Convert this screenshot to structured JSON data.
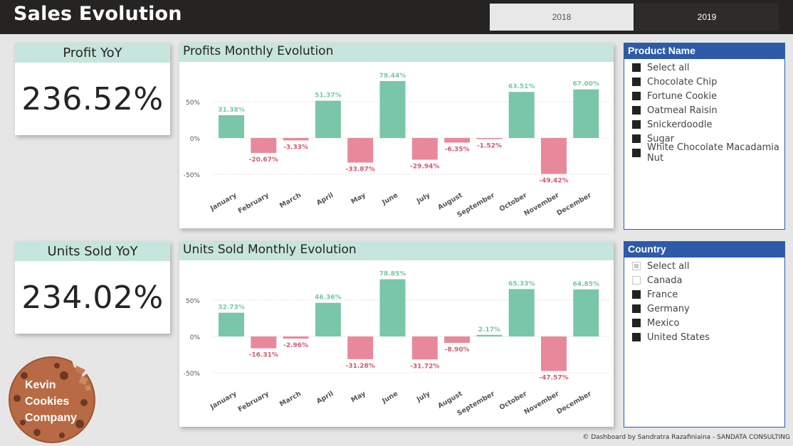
{
  "header": {
    "title": "Sales Evolution",
    "years": [
      "2018",
      "2019"
    ],
    "selected_year": "2019"
  },
  "kpis": {
    "profit": {
      "label": "Profit YoY",
      "value": "236.52%"
    },
    "units": {
      "label": "Units Sold YoY",
      "value": "234.02%"
    }
  },
  "colors": {
    "positive": "#79c6a9",
    "negative": "#e8899b",
    "positive_label": "#79c6a9",
    "negative_label": "#d25a72",
    "header_fill": "#c6e5dc",
    "slicer_blue": "#2d5ba8"
  },
  "chart_data": [
    {
      "type": "bar",
      "title": "Profits Monthly Evolution",
      "categories": [
        "January",
        "February",
        "March",
        "April",
        "May",
        "June",
        "July",
        "August",
        "September",
        "October",
        "November",
        "December"
      ],
      "values": [
        31.38,
        -20.67,
        -3.33,
        51.37,
        -33.87,
        78.44,
        -29.94,
        -6.35,
        -1.52,
        63.51,
        -49.42,
        67.0
      ],
      "data_labels": [
        "31.38%",
        "-20.67%",
        "-3.33%",
        "51.37%",
        "-33.87%",
        "78.44%",
        "-29.94%",
        "-6.35%",
        "-1.52%",
        "63.51%",
        "-49.42%",
        "67.00%"
      ],
      "yticks": [
        50,
        0,
        -50
      ],
      "ytick_labels": [
        "50%",
        "0%",
        "-50%"
      ],
      "ylim": [
        -50,
        80
      ],
      "grid": true,
      "legend": "none"
    },
    {
      "type": "bar",
      "title": "Units Sold Monthly Evolution",
      "categories": [
        "January",
        "February",
        "March",
        "April",
        "May",
        "June",
        "July",
        "August",
        "September",
        "October",
        "November",
        "December"
      ],
      "values": [
        32.73,
        -16.31,
        -2.96,
        46.36,
        -31.28,
        78.85,
        -31.72,
        -8.9,
        2.17,
        65.33,
        -47.57,
        64.85
      ],
      "data_labels": [
        "32.73%",
        "-16.31%",
        "-2.96%",
        "46.36%",
        "-31.28%",
        "78.85%",
        "-31.72%",
        "-8.90%",
        "2.17%",
        "65.33%",
        "-47.57%",
        "64.85%"
      ],
      "yticks": [
        50,
        0,
        -50
      ],
      "ytick_labels": [
        "50%",
        "0%",
        "-50%"
      ],
      "ylim": [
        -50,
        80
      ],
      "grid": true,
      "legend": "none"
    }
  ],
  "slicers": {
    "product": {
      "title": "Product Name",
      "items": [
        {
          "label": "Select all",
          "state": "on"
        },
        {
          "label": "Chocolate Chip",
          "state": "on"
        },
        {
          "label": "Fortune Cookie",
          "state": "on"
        },
        {
          "label": "Oatmeal Raisin",
          "state": "on"
        },
        {
          "label": "Snickerdoodle",
          "state": "on"
        },
        {
          "label": "Sugar",
          "state": "on"
        },
        {
          "label": "White Chocolate Macadamia Nut",
          "state": "on"
        }
      ]
    },
    "country": {
      "title": "Country",
      "items": [
        {
          "label": "Select all",
          "state": "partial"
        },
        {
          "label": "Canada",
          "state": "off"
        },
        {
          "label": "France",
          "state": "on"
        },
        {
          "label": "Germany",
          "state": "on"
        },
        {
          "label": "Mexico",
          "state": "on"
        },
        {
          "label": "United States",
          "state": "on"
        }
      ]
    }
  },
  "logo": {
    "lines": [
      "Kevin",
      "Cookies",
      "Company"
    ]
  },
  "footer": {
    "text": "© Dashboard by Sandratra Razafiniaina - SANDATA CONSULTING"
  }
}
